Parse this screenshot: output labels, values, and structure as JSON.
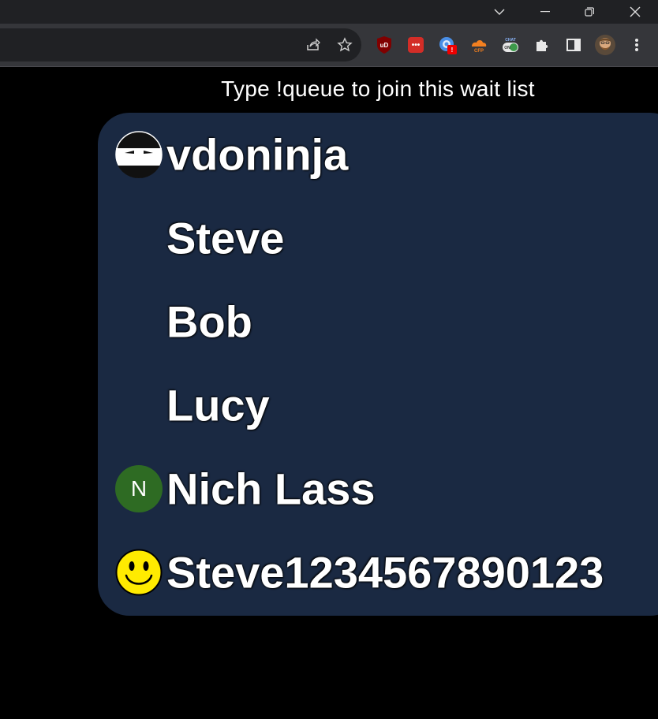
{
  "browser": {
    "window_controls": [
      "minimize",
      "restore",
      "close"
    ],
    "toolbar_icons": [
      "share-icon",
      "bookmark-star-icon",
      "ublock-origin-icon",
      "lastpass-icon",
      "extension-blue-icon",
      "cfp-extension-icon",
      "chat-toggle-icon",
      "extensions-puzzle-icon",
      "sidepanel-icon",
      "profile-avatar",
      "menu-kebab-icon"
    ],
    "extension_labels": {
      "ublock": "uD",
      "lastpass": "•••",
      "cfp": "CFP",
      "chat": "CHAT",
      "chat_toggle": "ON",
      "badge": "!"
    },
    "colors": {
      "titlebar": "#202124",
      "toolbar": "#35363a",
      "omnibox": "#202124"
    }
  },
  "queue": {
    "header": "Type !queue to join this wait list",
    "panel_color": "#1a2942",
    "items": [
      {
        "name": "vdoninja",
        "avatar": "ninja-avatar"
      },
      {
        "name": "Steve",
        "avatar": ""
      },
      {
        "name": "Bob",
        "avatar": ""
      },
      {
        "name": "Lucy",
        "avatar": ""
      },
      {
        "name": "Nich Lass",
        "avatar": "letter-avatar",
        "initial": "N",
        "avatar_color": "#2e6b23"
      },
      {
        "name": "Steve1234567890123",
        "avatar": "smiley-avatar"
      }
    ]
  }
}
